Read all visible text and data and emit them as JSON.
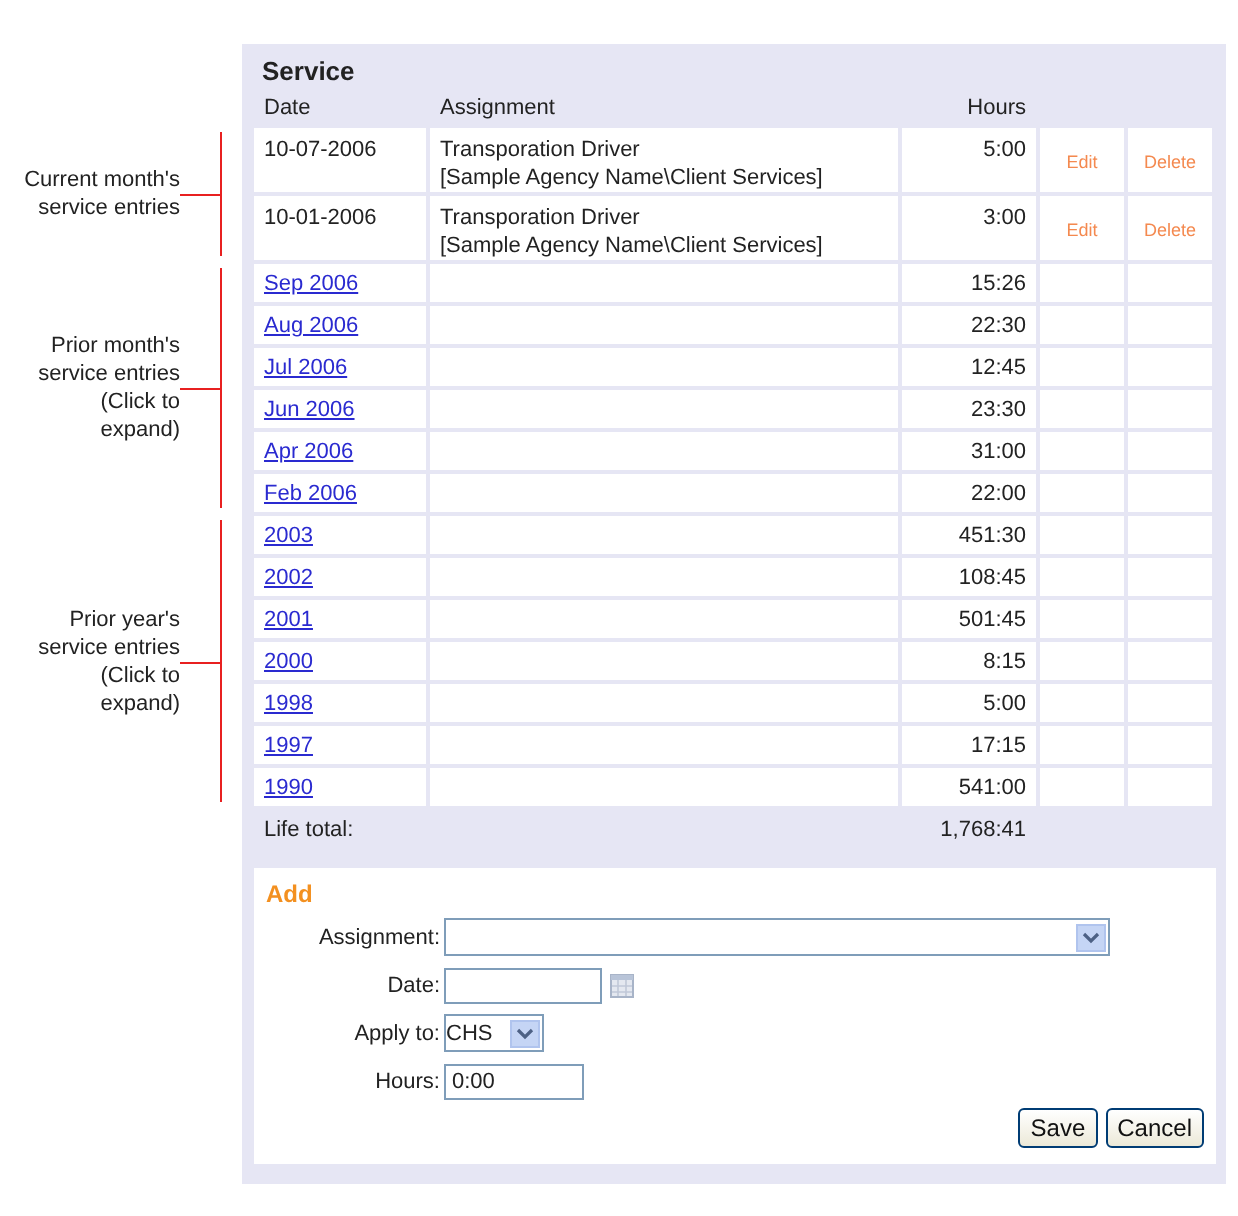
{
  "panel": {
    "title": "Service",
    "columns": [
      "Date",
      "Assignment",
      "Hours"
    ],
    "groups": [
      {
        "annotation": [
          "Current month's",
          "service entries"
        ],
        "rows": [
          {
            "kind": "entry",
            "date": "10-07-2006",
            "assignment": "Transporation Driver",
            "agency": "[Sample Agency Name\\Client Services]",
            "hours": "5:00",
            "edit": "Edit",
            "delete": "Delete"
          },
          {
            "kind": "entry",
            "date": "10-01-2006",
            "assignment": "Transporation Driver",
            "agency": "[Sample Agency Name\\Client Services]",
            "hours": "3:00",
            "edit": "Edit",
            "delete": "Delete"
          }
        ]
      },
      {
        "annotation": [
          "Prior month's",
          "service entries",
          "(Click to",
          "expand)"
        ],
        "rows": [
          {
            "kind": "link",
            "period": "Sep 2006",
            "hours": "15:26"
          },
          {
            "kind": "link",
            "period": "Aug 2006",
            "hours": "22:30"
          },
          {
            "kind": "link",
            "period": "Jul 2006",
            "hours": "12:45"
          },
          {
            "kind": "link",
            "period": "Jun 2006",
            "hours": "23:30"
          },
          {
            "kind": "link",
            "period": "Apr 2006",
            "hours": "31:00"
          },
          {
            "kind": "link",
            "period": "Feb 2006",
            "hours": "22:00"
          }
        ]
      },
      {
        "annotation": [
          "Prior year's",
          "service entries",
          "(Click to",
          "expand)"
        ],
        "rows": [
          {
            "kind": "link",
            "period": "2003",
            "hours": "451:30"
          },
          {
            "kind": "link",
            "period": "2002",
            "hours": "108:45"
          },
          {
            "kind": "link",
            "period": "2001",
            "hours": "501:45"
          },
          {
            "kind": "link",
            "period": "2000",
            "hours": "8:15"
          },
          {
            "kind": "link",
            "period": "1998",
            "hours": "5:00"
          },
          {
            "kind": "link",
            "period": "1997",
            "hours": "17:15"
          },
          {
            "kind": "link",
            "period": "1990",
            "hours": "541:00"
          }
        ]
      }
    ],
    "total": {
      "label": "Life total:",
      "hours": "1,768:41"
    }
  },
  "add": {
    "title": "Add",
    "fields": [
      {
        "kind": "select",
        "label": "Assignment:"
      },
      {
        "kind": "date",
        "label": "Date:"
      },
      {
        "kind": "short-select",
        "label": "Apply to:",
        "value": "CHS"
      },
      {
        "kind": "text",
        "label": "Hours:",
        "value": "0:00"
      }
    ],
    "buttons": [
      "Save",
      "Cancel"
    ]
  }
}
